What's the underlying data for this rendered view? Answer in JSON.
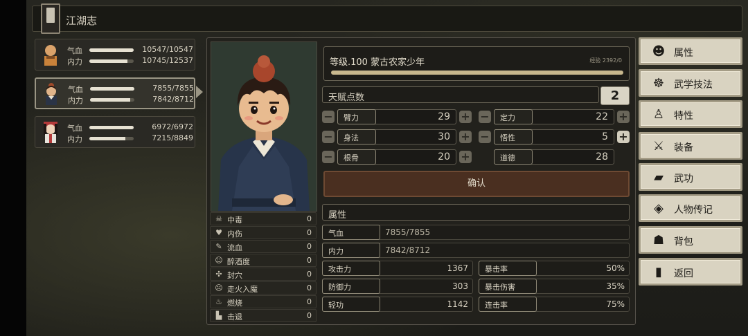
{
  "title": "江湖志",
  "party": [
    {
      "hp_label": "气血",
      "hp": "10547/10547",
      "hp_frac": 1.0,
      "mp_label": "内力",
      "mp": "10745/12537",
      "mp_frac": 0.857
    },
    {
      "hp_label": "气血",
      "hp": "7855/7855",
      "hp_frac": 1.0,
      "mp_label": "内力",
      "mp": "7842/8712",
      "mp_frac": 0.9
    },
    {
      "hp_label": "气血",
      "hp": "6972/6972",
      "hp_frac": 1.0,
      "mp_label": "内力",
      "mp": "7215/8849",
      "mp_frac": 0.815
    }
  ],
  "status_effects": [
    {
      "label": "中毒",
      "value": "0",
      "icon": "skull-icon"
    },
    {
      "label": "内伤",
      "value": "0",
      "icon": "broken-heart-icon"
    },
    {
      "label": "流血",
      "value": "0",
      "icon": "blood-drop-icon"
    },
    {
      "label": "醉酒度",
      "value": "0",
      "icon": "dizzy-icon"
    },
    {
      "label": "封穴",
      "value": "0",
      "icon": "acupoint-icon"
    },
    {
      "label": "走火入魔",
      "value": "0",
      "icon": "demon-face-icon"
    },
    {
      "label": "燃烧",
      "value": "0",
      "icon": "flame-icon"
    },
    {
      "label": "击退",
      "value": "0",
      "icon": "knockback-icon"
    }
  ],
  "character": {
    "level_text": "等级.100 蒙古农家少年",
    "exp_text": "经验 2392/0",
    "exp_frac": 1.0
  },
  "talent": {
    "label": "天赋点数",
    "points": "2"
  },
  "stats": [
    {
      "label": "臂力",
      "value": "29"
    },
    {
      "label": "定力",
      "value": "22"
    },
    {
      "label": "身法",
      "value": "30"
    },
    {
      "label": "悟性",
      "value": "5"
    },
    {
      "label": "根骨",
      "value": "20"
    },
    {
      "label": "道德",
      "value": "28"
    }
  ],
  "confirm_label": "确认",
  "attributes": {
    "header": "属性",
    "hp": {
      "label": "气血",
      "value": "7855/7855"
    },
    "mp": {
      "label": "内力",
      "value": "7842/8712"
    },
    "grid": [
      {
        "label": "攻击力",
        "value": "1367"
      },
      {
        "label": "暴击率",
        "value": "50%"
      },
      {
        "label": "防御力",
        "value": "303"
      },
      {
        "label": "暴击伤害",
        "value": "35%"
      },
      {
        "label": "轻功",
        "value": "1142"
      },
      {
        "label": "连击率",
        "value": "75%"
      }
    ]
  },
  "menu": [
    {
      "label": "属性",
      "icon": "character-icon"
    },
    {
      "label": "武学技法",
      "icon": "martial-skills-icon"
    },
    {
      "label": "特性",
      "icon": "traits-icon"
    },
    {
      "label": "装备",
      "icon": "sword-icon"
    },
    {
      "label": "武功",
      "icon": "manual-book-icon"
    },
    {
      "label": "人物传记",
      "icon": "biography-icon"
    },
    {
      "label": "背包",
      "icon": "bag-icon"
    },
    {
      "label": "返回",
      "icon": "exit-door-icon"
    }
  ]
}
